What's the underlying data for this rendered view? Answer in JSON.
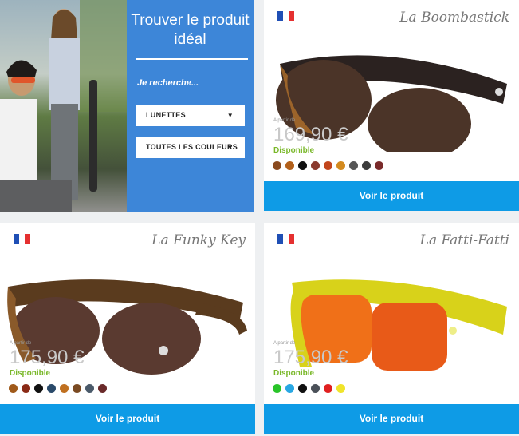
{
  "finder": {
    "title": "Trouver le produit idéal",
    "subtitle": "Je recherche...",
    "product_select": "LUNETTES",
    "color_select": "TOUTES LES COULEURS"
  },
  "products": [
    {
      "brand": "La Boombastick",
      "price_from": "A partir de",
      "price": "169,90 €",
      "availability": "Disponible",
      "cta": "Voir le produit",
      "flag": "fr-flag",
      "swatches": [
        "#8a4a1e",
        "#b2601a",
        "#111111",
        "#8a3a2e",
        "#c2461c",
        "#d38a1e",
        "#565656",
        "#3c3c3c",
        "#7a2a2a"
      ],
      "frame_color": "#2b2220",
      "lens_color": "#4b3428"
    },
    {
      "brand": "La Funky Key",
      "price_from": "A partir de",
      "price": "175,90 €",
      "availability": "Disponible",
      "cta": "Voir le produit",
      "flag": "fr-flag",
      "swatches": [
        "#a05a1a",
        "#8a2a16",
        "#111111",
        "#2a4a6a",
        "#c07020",
        "#7a4a22",
        "#4a5a6a",
        "#6a2a2a"
      ],
      "frame_color": "#5a3b1e",
      "lens_color": "#5a3a30"
    },
    {
      "brand": "La Fatti-Fatti",
      "price_from": "A partir de",
      "price": "175,90 €",
      "availability": "Disponible",
      "cta": "Voir le produit",
      "flag": "fr-flag",
      "swatches": [
        "#29c429",
        "#28a7e3",
        "#111111",
        "#4a5058",
        "#e02020",
        "#f0e42a"
      ],
      "frame_color": "#d8d21a",
      "lens_color": "#f07018"
    }
  ],
  "flag_colors": [
    "#1f4fb5",
    "#ffffff",
    "#e53030"
  ],
  "accent": "#0e9be6",
  "finder_bg": "#3d86d8"
}
